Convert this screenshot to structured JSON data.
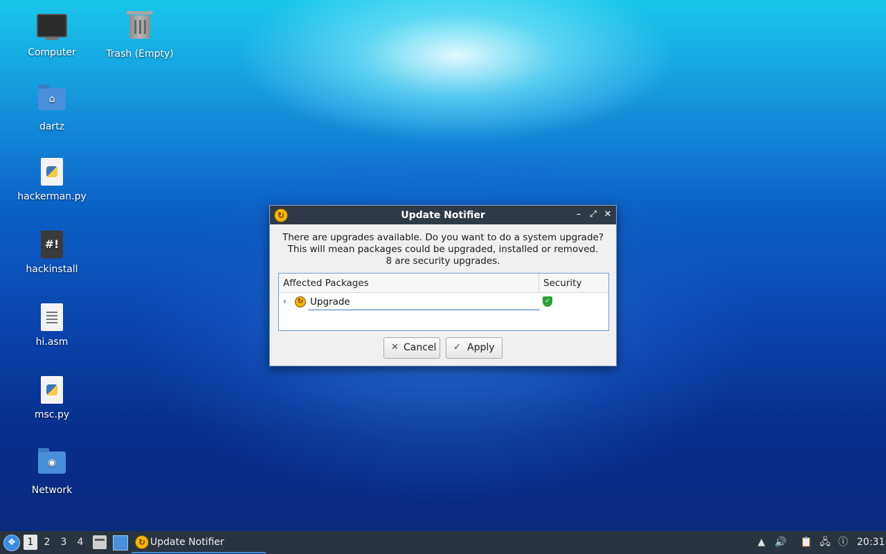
{
  "desktop": {
    "icons": [
      {
        "label": "Computer",
        "icon": "computer-icon"
      },
      {
        "label": "Trash (Empty)",
        "icon": "trash-icon"
      },
      {
        "label": "dartz",
        "icon": "home-folder-icon"
      },
      {
        "label": "hackerman.py",
        "icon": "python-file-icon"
      },
      {
        "label": "hackinstall",
        "icon": "script-file-icon"
      },
      {
        "label": "hi.asm",
        "icon": "text-file-icon"
      },
      {
        "label": "msc.py",
        "icon": "python-file-icon"
      },
      {
        "label": "Network",
        "icon": "network-folder-icon"
      }
    ]
  },
  "dialog": {
    "title": "Update Notifier",
    "message_lines": [
      "There are upgrades available. Do you want to do a system upgrade?",
      "This will mean packages could be upgraded, installed or removed.",
      "8 are security upgrades."
    ],
    "table": {
      "columns": [
        "Affected Packages",
        "Security"
      ],
      "rows": [
        {
          "label": "Upgrade",
          "security": "shield-check-icon"
        }
      ]
    },
    "buttons": {
      "cancel": "Cancel",
      "apply": "Apply"
    }
  },
  "taskbar": {
    "workspaces": [
      "1",
      "2",
      "3",
      "4"
    ],
    "active_workspace": "1",
    "task": "Update Notifier",
    "clock": "20:31"
  },
  "colors": {
    "titlebar": "#2f3a47",
    "taskbar": "#2a3440",
    "accent": "#3a8ee0"
  }
}
